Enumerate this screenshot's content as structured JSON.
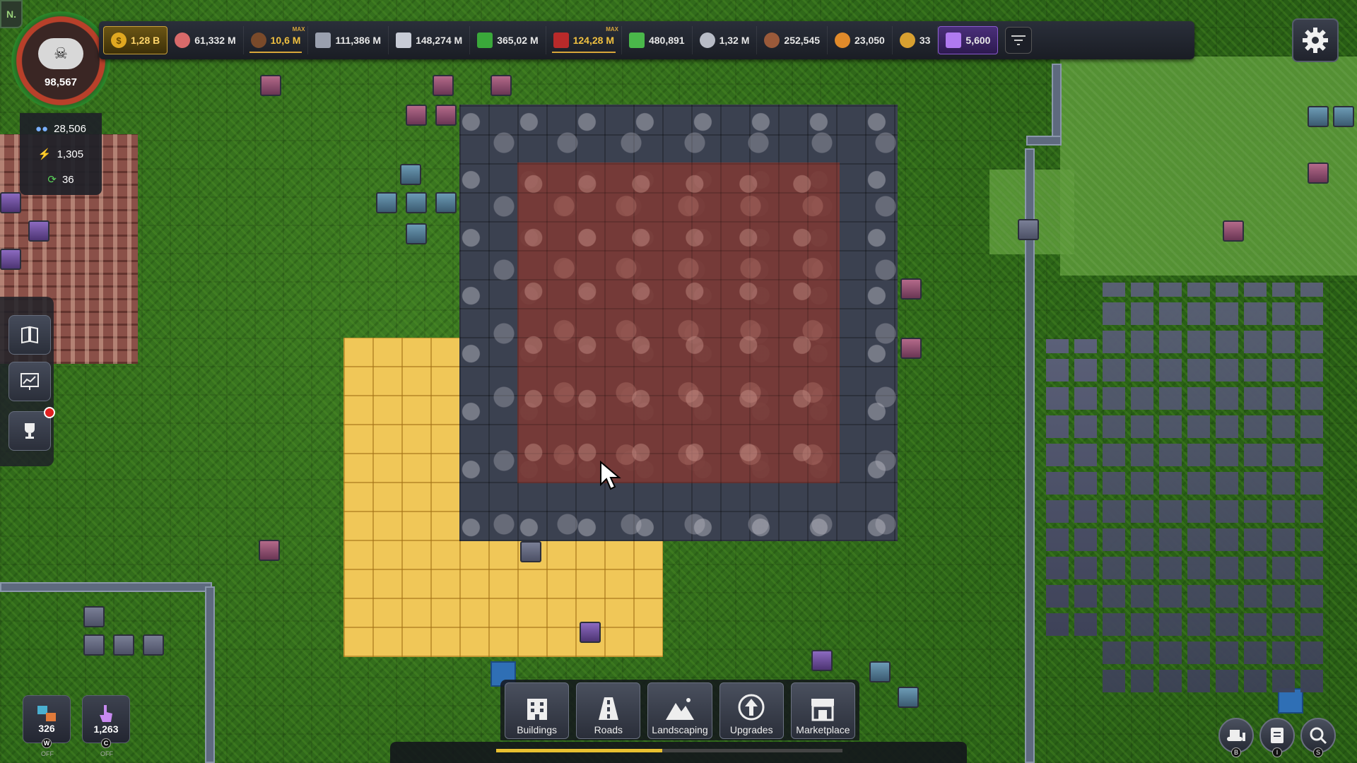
{
  "app": {
    "corner_logo": "N."
  },
  "resources": [
    {
      "id": "coins",
      "icon": "coin-icon",
      "value": "1,28 B",
      "active": true
    },
    {
      "id": "meat",
      "icon": "meat-icon",
      "value": "61,332 M"
    },
    {
      "id": "wood",
      "icon": "wood-icon",
      "value": "10,6 M",
      "max": "MAX",
      "warn": true
    },
    {
      "id": "metal",
      "icon": "metal-bars-icon",
      "value": "111,386 M"
    },
    {
      "id": "planks",
      "icon": "planks-icon",
      "value": "148,274 M"
    },
    {
      "id": "cash",
      "icon": "cash-icon",
      "value": "365,02 M"
    },
    {
      "id": "bricks",
      "icon": "bricks-icon",
      "value": "124,28 M",
      "max": "MAX",
      "warn": true
    },
    {
      "id": "crystal",
      "icon": "crystal-icon",
      "value": "480,891"
    },
    {
      "id": "stone",
      "icon": "stone-icon",
      "value": "1,32 M"
    },
    {
      "id": "wheat",
      "icon": "wheat-icon",
      "value": "252,545"
    },
    {
      "id": "leaf",
      "icon": "leaf-icon",
      "value": "23,050"
    },
    {
      "id": "token",
      "icon": "token-icon",
      "value": "33"
    },
    {
      "id": "gems",
      "icon": "gem-icon",
      "value": "5,600",
      "gem": true
    }
  ],
  "pollution": {
    "value": "98,567",
    "icon": "skull-cloud-icon"
  },
  "stats": [
    {
      "icon": "population-icon",
      "value": "28,506",
      "color": "#7ab0ff"
    },
    {
      "icon": "lightning-icon",
      "value": "1,305",
      "color": "#f0d030"
    },
    {
      "icon": "cycle-icon",
      "value": "36",
      "color": "#5ad05a"
    }
  ],
  "side_buttons": [
    {
      "name": "guide-book-button",
      "icon": "book-icon"
    },
    {
      "name": "stats-chart-button",
      "icon": "chart-icon"
    },
    {
      "name": "achievements-button",
      "icon": "trophy-icon"
    }
  ],
  "mini_buttons": [
    {
      "name": "workers-button",
      "value": "326",
      "key": "W",
      "state": "OFF"
    },
    {
      "name": "clicker-button",
      "value": "1,263",
      "key": "C",
      "state": "OFF"
    }
  ],
  "toolbar": [
    {
      "name": "buildings-button",
      "label": "Buildings",
      "icon": "building-icon"
    },
    {
      "name": "roads-button",
      "label": "Roads",
      "icon": "road-icon"
    },
    {
      "name": "landscaping-button",
      "label": "Landscaping",
      "icon": "mountain-icon"
    },
    {
      "name": "upgrades-button",
      "label": "Upgrades",
      "icon": "upgrade-arrow-icon"
    },
    {
      "name": "marketplace-button",
      "label": "Marketplace",
      "icon": "shop-icon"
    }
  ],
  "progress": {
    "fraction": 0.48,
    "color": "#e8c030"
  },
  "bottom_right": [
    {
      "name": "bulldozer-button",
      "key": "B",
      "icon": "bulldozer-icon"
    },
    {
      "name": "info-button",
      "key": "I",
      "icon": "info-icon"
    },
    {
      "name": "search-button",
      "key": "S",
      "icon": "magnifier-icon"
    }
  ]
}
